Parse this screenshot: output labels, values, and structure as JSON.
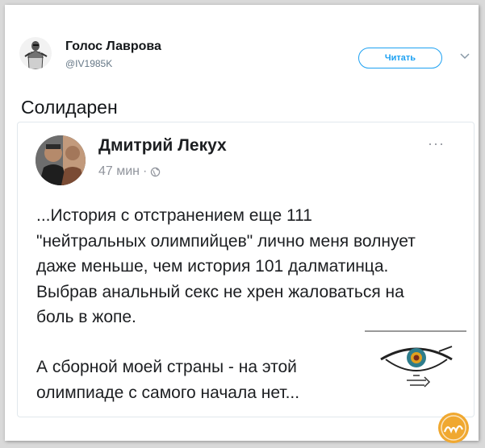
{
  "tweet": {
    "author_name": "Голос Лаврова",
    "author_handle": "@IV1985K",
    "follow_label": "Читать",
    "text": "Солидарен"
  },
  "quoted_post": {
    "author_name": "Дмитрий Лекух",
    "timestamp": "47 мин",
    "separator": "·",
    "more_label": "···",
    "paragraph_1": "...История с отстранением еще 111 \"нейтральных олимпийцев\" лично меня волнует даже меньше, чем история 101 далматинца. Выбрав анальный секс не хрен жаловаться на боль в жопе.",
    "paragraph_2": "А сборной моей страны - на этой олимпиаде с самого начала нет..."
  },
  "icons": {
    "avatar": "avatar-photo",
    "caret": "chevron-down-icon",
    "globe": "globe-icon",
    "eye_logo": "eye-logo",
    "watermark": "watermark-logo"
  },
  "colors": {
    "accent": "#1da1f2",
    "text": "#14171a",
    "muted": "#657786",
    "watermark": "#f0a830"
  }
}
